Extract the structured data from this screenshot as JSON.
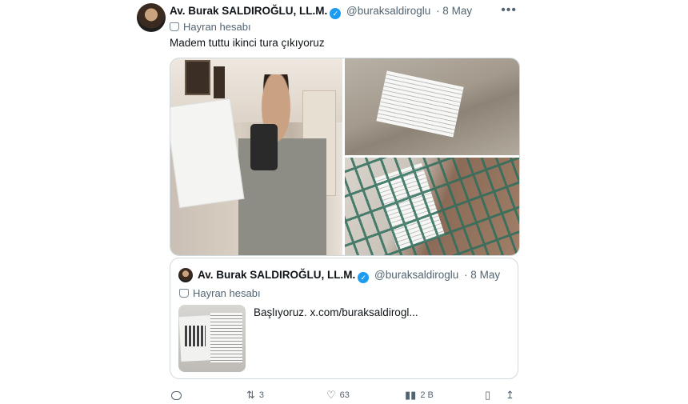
{
  "author": {
    "name": "Av. Burak SALDIROĞLU, LL.M.",
    "handle": "@buraksaldiroglu",
    "date": "· 8 May",
    "badge": "Hayran hesabı"
  },
  "tweet_text": "Madem tuttu ikinci tura çıkıyoruz",
  "more_label": "•••",
  "quote": {
    "name": "Av. Burak SALDIROĞLU, LL.M.",
    "handle": "@buraksaldiroglu",
    "date": "· 8 May",
    "badge": "Hayran hesabı",
    "text": "Başlıyoruz.  x.com/buraksaldirogl..."
  },
  "actions": {
    "replies": "",
    "retweets": "3",
    "likes": "63",
    "views": "2 B"
  },
  "icons": [
    "verified-badge-icon",
    "fan-account-icon",
    "reply-icon",
    "retweet-icon",
    "like-icon",
    "views-icon",
    "bookmark-icon",
    "share-icon"
  ],
  "colors": {
    "verified": "#1d9bf0",
    "secondary_text": "#536471",
    "border": "#cfd9de"
  }
}
